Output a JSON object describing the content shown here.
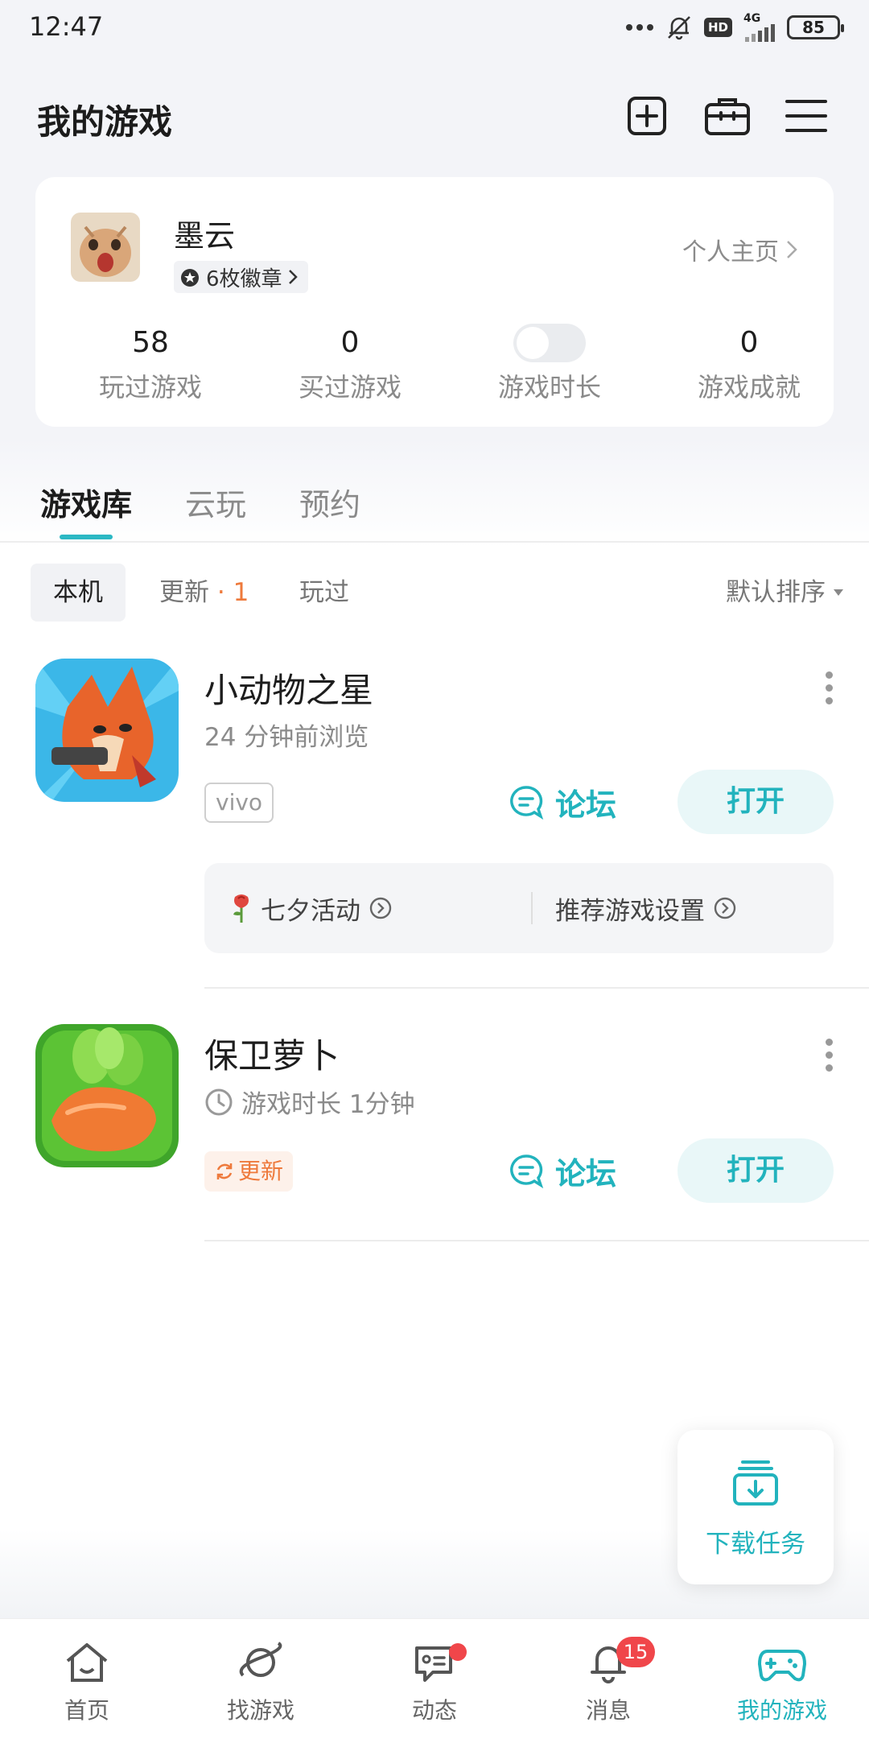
{
  "status_bar": {
    "time": "12:47",
    "network": "4G",
    "hd": "HD",
    "battery": "85",
    "icons": [
      "more-dots-icon",
      "mute-bell-icon",
      "hd-icon",
      "signal-icon",
      "battery-icon"
    ]
  },
  "header": {
    "title": "我的游戏",
    "icons": [
      "add-icon",
      "toolbox-icon",
      "menu-icon"
    ]
  },
  "profile": {
    "name": "墨云",
    "badges": "6枚徽章",
    "home_link": "个人主页",
    "stats": [
      {
        "value": "58",
        "label": "玩过游戏"
      },
      {
        "value": "0",
        "label": "买过游戏"
      },
      {
        "value": "",
        "label": "游戏时长"
      },
      {
        "value": "0",
        "label": "游戏成就"
      }
    ]
  },
  "tabs": [
    {
      "label": "游戏库",
      "active": true
    },
    {
      "label": "云玩",
      "active": false
    },
    {
      "label": "预约",
      "active": false
    }
  ],
  "filters": {
    "local": "本机",
    "update": "更新",
    "update_count": "· 1",
    "played": "玩过",
    "sort": "默认排序"
  },
  "games": [
    {
      "name": "小动物之星",
      "subtitle": "24 分钟前浏览",
      "tag": "vivo",
      "forum": "论坛",
      "open": "打开",
      "activity_1": "七夕活动",
      "activity_2": "推荐游戏设置"
    },
    {
      "name": "保卫萝卜",
      "subtitle": "游戏时长 1分钟",
      "tag": "更新",
      "forum": "论坛",
      "open": "打开"
    }
  ],
  "download_task": {
    "label": "下载任务"
  },
  "bottom_nav": [
    {
      "label": "首页",
      "icon": "home-icon"
    },
    {
      "label": "找游戏",
      "icon": "planet-icon"
    },
    {
      "label": "动态",
      "icon": "feed-icon"
    },
    {
      "label": "消息",
      "icon": "bell-icon",
      "badge": "15"
    },
    {
      "label": "我的游戏",
      "icon": "gamepad-icon",
      "active": true
    }
  ],
  "colors": {
    "accent": "#22b3bd",
    "update_orange": "#ee7a3c",
    "badge_red": "#f0464a"
  }
}
